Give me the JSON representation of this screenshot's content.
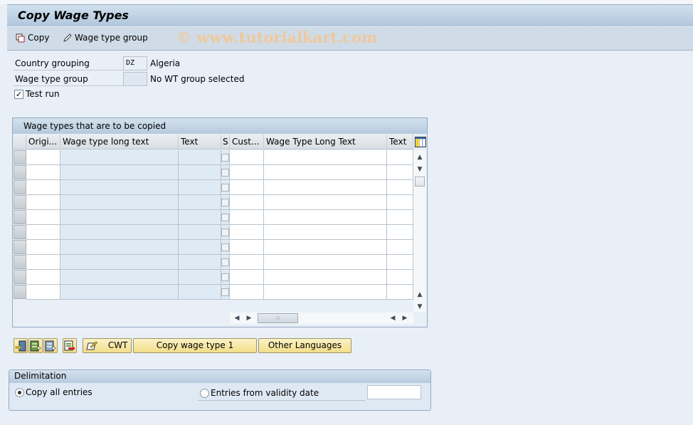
{
  "window": {
    "title": "Copy Wage Types"
  },
  "toolbar": {
    "copy_label": "Copy",
    "wage_type_group_label": "Wage type group",
    "watermark": "© www.tutorialkart.com"
  },
  "form": {
    "country_grouping": {
      "label": "Country grouping",
      "value": "DZ",
      "description": "Algeria"
    },
    "wage_type_group": {
      "label": "Wage type group",
      "value": "",
      "description": "No WT group selected"
    },
    "test_run": {
      "label": "Test run",
      "checked": true,
      "mark": "✓"
    }
  },
  "table": {
    "title": "Wage types that are to be copied",
    "columns": [
      "Origi...",
      "Wage type long text",
      "Text",
      "S",
      "Cust...",
      "Wage Type Long Text",
      "Text"
    ],
    "row_count": 11,
    "rows": []
  },
  "buttons": {
    "cwt_label": "CWT",
    "copy_wage_type_label": "Copy wage type 1",
    "other_languages_label": "Other Languages"
  },
  "delimitation": {
    "title": "Delimitation",
    "copy_all_label": "Copy all entries",
    "copy_all_selected": true,
    "from_date_label": "Entries from validity date",
    "from_date_selected": false,
    "date_value": ""
  }
}
